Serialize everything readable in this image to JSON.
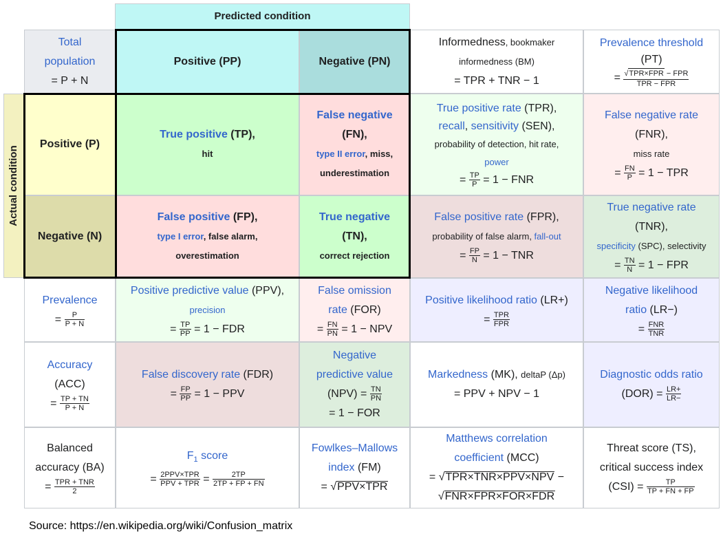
{
  "header": {
    "predicted_condition": "Predicted condition",
    "actual_condition": "Actual condition"
  },
  "total": {
    "l1": "Total",
    "l2": "population",
    "l3": "= P + N"
  },
  "pp": "Positive (PP)",
  "pn": "Negative (PN)",
  "ap": "Positive (P)",
  "an": "Negative (N)",
  "bm": {
    "t1": "Informedness",
    "t2": ", bookmaker",
    "t3": "informedness (BM)",
    "t4": "= TPR + TNR − 1"
  },
  "pt": {
    "t1": "Prevalence threshold",
    "t2": "(PT)",
    "num": "TPR×FPR",
    "num2": " − FPR",
    "den": "TPR − FPR"
  },
  "tp": {
    "t1": "True positive",
    "t2": " (TP),",
    "t3": "hit"
  },
  "fn": {
    "t1": "False negative",
    "t2": "(FN),",
    "t3": "type II error",
    "t4": ", miss,",
    "t5": "underestimation"
  },
  "tpr": {
    "t1": "True positive rate",
    "t2": " (TPR),",
    "t3": "recall",
    "t4": ", ",
    "t5": "sensitivity",
    "t6": " (SEN),",
    "t7": "probability of detection, hit rate,",
    "t8": "power",
    "num": "TP",
    "den": "P",
    "t9": "= 1 − FNR"
  },
  "fnr": {
    "t1": "False negative rate",
    "t2": "(FNR),",
    "t3": "miss rate",
    "num": "FN",
    "den": "P",
    "t4": "= 1 − TPR"
  },
  "fp": {
    "t1": "False positive",
    "t2": " (FP),",
    "t3": "type I error",
    "t4": ", false alarm,",
    "t5": "overestimation"
  },
  "tn": {
    "t1": "True negative",
    "t2": "(TN),",
    "t3": "correct rejection"
  },
  "fpr": {
    "t1": "False positive rate",
    "t2": " (FPR),",
    "t3": "probability of false alarm, ",
    "t4": "fall-out",
    "num": "FP",
    "den": "N",
    "t5": "= 1 − TNR"
  },
  "tnr": {
    "t1": "True negative rate",
    "t2": "(TNR),",
    "t3": "specificity",
    "t4": " (SPC), selectivity",
    "num": "TN",
    "den": "N",
    "t5": "= 1 − FPR"
  },
  "prev": {
    "t1": "Prevalence",
    "num": "P",
    "den": "P + N"
  },
  "ppv": {
    "t1": "Positive predictive value",
    "t2": " (PPV),",
    "t3": "precision",
    "num": "TP",
    "den": "PP",
    "t4": "= 1 − FDR"
  },
  "for": {
    "t1": "False omission",
    "t2": "rate",
    "t3": " (FOR)",
    "num": "FN",
    "den": "PN",
    "t4": "= 1 − NPV"
  },
  "lrp": {
    "t1": "Positive likelihood ratio",
    "t2": " (LR+)",
    "num": "TPR",
    "den": "FPR"
  },
  "lrn": {
    "t1": "Negative likelihood",
    "t2": "ratio",
    "t3": " (LR−)",
    "num": "FNR",
    "den": "TNR"
  },
  "acc": {
    "t1": "Accuracy",
    "t2": "(ACC)",
    "num": "TP + TN",
    "den": "P + N"
  },
  "fdr": {
    "t1": "False discovery rate",
    "t2": " (FDR)",
    "num": "FP",
    "den": "PP",
    "t3": "= 1 − PPV"
  },
  "npv": {
    "t1": "Negative",
    "t2": "predictive value",
    "t3": "(NPV) = ",
    "num": "TN",
    "den": "PN",
    "t4": "= 1 − FOR"
  },
  "mk": {
    "t1": "Markedness",
    "t2": " (MK), ",
    "t3": "deltaP (Δp)",
    "t4": "= PPV + NPV − 1"
  },
  "dor": {
    "t1": "Diagnostic odds ratio",
    "t2": "(DOR) = ",
    "num": "LR+",
    "den": "LR−"
  },
  "ba": {
    "t1": "Balanced",
    "t2": "accuracy (BA)",
    "num": "TPR + TNR",
    "den": "2"
  },
  "f1": {
    "t1": "F",
    "t1sub": "1",
    "t2": " score",
    "num1": "2PPV×TPR",
    "den1": "PPV + TPR",
    "num2": "2TP",
    "den2": "2TP + FP + FN"
  },
  "fm": {
    "t1": "Fowlkes–Mallows",
    "t2": "index",
    "t3": " (FM)",
    "t4": "= ",
    "rad": "PPV×TPR"
  },
  "mcc": {
    "t1": "Matthews correlation",
    "t2": "coefficient",
    "t3": " (MCC)",
    "rad1": "TPR×TNR×PPV×NPV",
    "t4": " −",
    "rad2": "FNR×FPR×FOR×FDR"
  },
  "ts": {
    "t1": "Threat score (TS),",
    "t2": "critical success index",
    "t3": "(CSI) = ",
    "num": "TP",
    "den": "TP + FN + FP"
  },
  "source": "Source: https://en.wikipedia.org/wiki/Confusion_matrix",
  "colors": {
    "predicted_header": "#bff7f5",
    "total": "#eaecf0",
    "pp": "#bff7f5",
    "pn": "#aadddd",
    "actual_side": "#f3f1c0",
    "ap": "#ffffcc",
    "an": "#dddcaa",
    "tp": "#ccffcc",
    "fn": "#ffdddd",
    "light_green": "#eeffee",
    "light_red": "#ffeeee",
    "mauve": "#eedddd",
    "green2": "#ddeedd",
    "lavender": "#eeeeff",
    "link": "#3366cc"
  }
}
